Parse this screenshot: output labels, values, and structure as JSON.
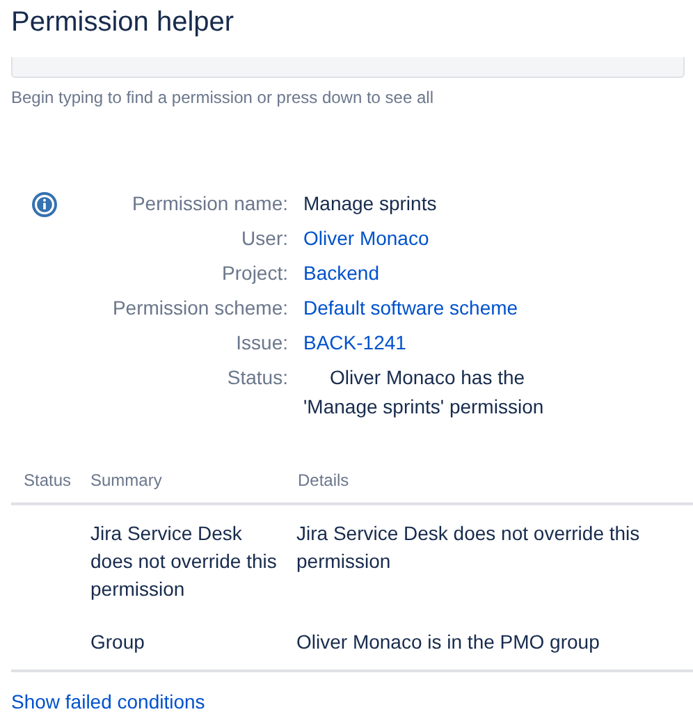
{
  "title": "Permission helper",
  "permission_field": {
    "kind": "field"
  },
  "help_text": "Begin typing to find a permission or press down to see all",
  "details": [
    {
      "label": "Permission name:",
      "value": "Manage sprints",
      "kind": "text"
    },
    {
      "label": "User:",
      "value": "Oliver Monaco",
      "kind": "link"
    },
    {
      "label": "Project:",
      "value": "Backend",
      "kind": "link"
    },
    {
      "label": "Permission scheme:",
      "value": "Default software scheme",
      "kind": "link"
    },
    {
      "label": "Issue:",
      "value": "BACK-1241",
      "kind": "link"
    },
    {
      "label": "Status:",
      "value": "Oliver Monaco has the 'Manage sprints' permission",
      "kind": "status"
    }
  ],
  "table": {
    "columns": [
      "Status",
      "Summary",
      "Details"
    ],
    "rows": [
      {
        "summary": "Jira Service Desk does not override this permission",
        "details": "Jira Service Desk does not override this permission"
      },
      {
        "summary": "Group",
        "details": "Oliver Monaco is in the PMO group"
      }
    ]
  },
  "show_failed_link": "Show failed conditions"
}
